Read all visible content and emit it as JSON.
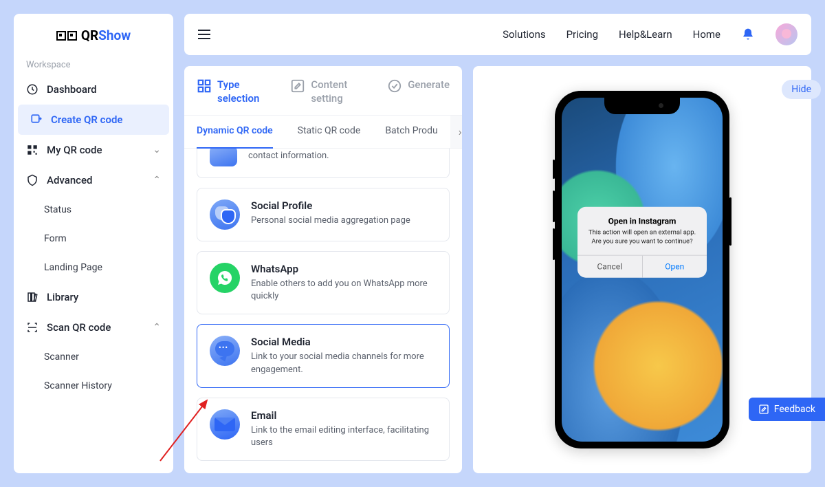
{
  "brand": {
    "prefix": "QR",
    "suffix": "Show"
  },
  "sidebar": {
    "workspace_label": "Workspace",
    "dashboard": "Dashboard",
    "create": "Create QR code",
    "myqr": "My QR code",
    "advanced": "Advanced",
    "status": "Status",
    "form": "Form",
    "landing": "Landing Page",
    "library": "Library",
    "scan": "Scan QR code",
    "scanner": "Scanner",
    "scanner_history": "Scanner History"
  },
  "topbar": {
    "solutions": "Solutions",
    "pricing": "Pricing",
    "help": "Help&Learn",
    "home": "Home"
  },
  "steps": {
    "type": "Type selection",
    "content": "Content setting",
    "generate": "Generate"
  },
  "tabs": {
    "dynamic": "Dynamic QR code",
    "static": "Static QR code",
    "batch": "Batch Produ"
  },
  "cards": {
    "contact_desc": "contact information.",
    "social_profile_title": "Social Profile",
    "social_profile_desc": "Personal social media aggregation page",
    "whatsapp_title": "WhatsApp",
    "whatsapp_desc": "Enable others to add you on WhatsApp more quickly",
    "social_media_title": "Social Media",
    "social_media_desc": "Link to your social media channels for more engagement.",
    "email_title": "Email",
    "email_desc": "Link to the email editing interface, facilitating users"
  },
  "preview": {
    "hide": "Hide",
    "dialog_title": "Open in Instagram",
    "dialog_msg1": "This action will open an external app.",
    "dialog_msg2": "Are you sure you want to continue?",
    "cancel": "Cancel",
    "open": "Open"
  },
  "feedback": "Feedback"
}
